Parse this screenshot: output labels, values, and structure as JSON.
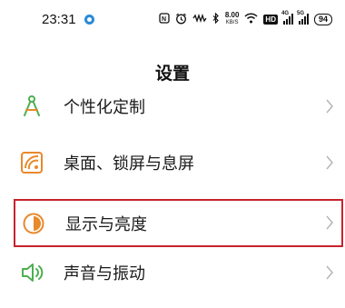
{
  "status_bar": {
    "time": "23:31",
    "speed_value": "8.00",
    "speed_unit": "KB/S",
    "hd_badge": "HD",
    "signal1_label": "4G",
    "signal2_label": "5G",
    "battery": "94"
  },
  "page": {
    "title": "设置"
  },
  "settings": {
    "items": [
      {
        "label": "个性化定制",
        "icon": "compass-icon"
      },
      {
        "label": "桌面、锁屏与息屏",
        "icon": "wallpaper-icon"
      },
      {
        "label": "显示与亮度",
        "icon": "brightness-icon",
        "highlighted": true
      },
      {
        "label": "声音与振动",
        "icon": "speaker-icon"
      }
    ]
  },
  "colors": {
    "accent_orange": "#e8892b",
    "accent_green": "#4caf50",
    "highlight_border": "#c8232c",
    "chevron": "#b5b5b5"
  }
}
